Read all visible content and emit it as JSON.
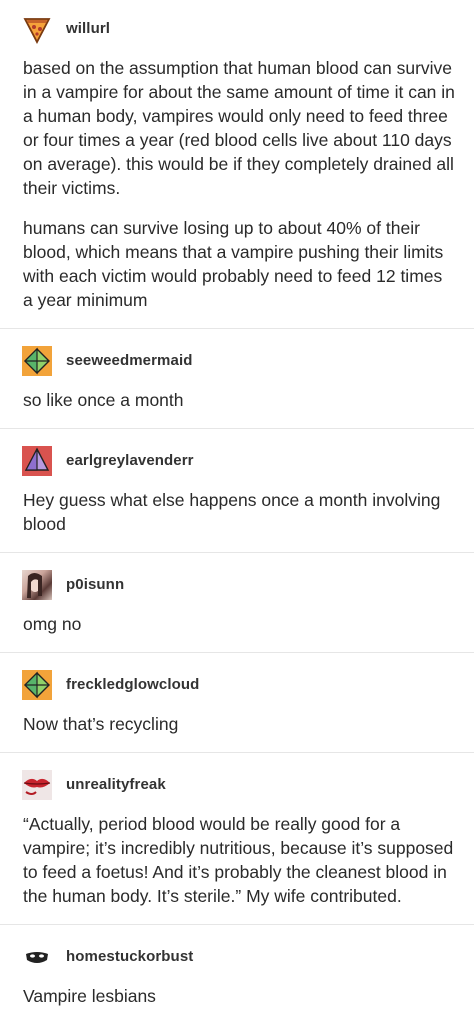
{
  "posts": [
    {
      "username": "willurl",
      "paragraphs": [
        "based on the assumption that human blood can survive in a vampire for about the same amount of time it can in a human body, vampires would only need to feed three or four times a year (red blood cells live about 110 days on average). this would be if they completely drained all their victims.",
        "humans can survive losing up to about 40% of their blood, which means that a vampire pushing their limits with each victim would probably need to feed 12 times a year minimum"
      ]
    },
    {
      "username": "seeweedmermaid",
      "paragraphs": [
        "so like once a month"
      ]
    },
    {
      "username": "earlgreylavenderr",
      "paragraphs": [
        "Hey guess what else happens once a month involving blood"
      ]
    },
    {
      "username": "p0isunn",
      "paragraphs": [
        "omg no"
      ]
    },
    {
      "username": "freckledglowcloud",
      "paragraphs": [
        "Now that’s recycling"
      ]
    },
    {
      "username": "unrealityfreak",
      "paragraphs": [
        "“Actually, period blood would be really good for a vampire; it’s incredibly nutritious, because it’s supposed to feed a foetus! And it’s probably the cleanest blood in the human body. It’s sterile.” My wife contributed."
      ]
    },
    {
      "username": "homestuckorbust",
      "paragraphs": [
        "Vampire lesbians"
      ]
    }
  ],
  "colors": {
    "divider": "#e6e6e6",
    "orange_avatar": "#f0a030",
    "red_avatar": "#d9534f"
  },
  "icons": [
    "pizza-slice-icon",
    "octahedron-icon",
    "octahedron-icon",
    "photo-avatar",
    "octahedron-icon",
    "lips-photo-avatar",
    "mask-icon"
  ]
}
